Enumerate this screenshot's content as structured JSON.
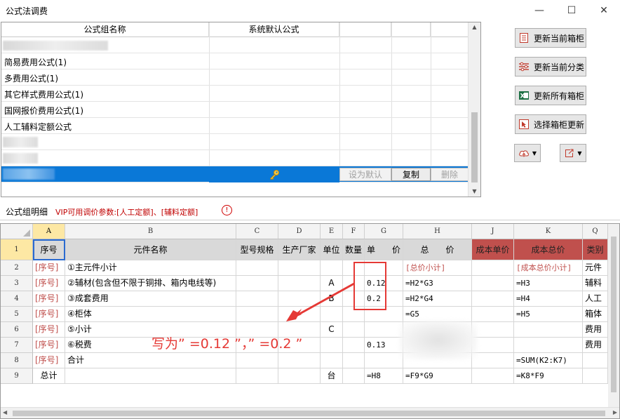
{
  "window": {
    "title": "公式法调费",
    "minimize": "—",
    "maximize": "☐",
    "close": "✕"
  },
  "list": {
    "columns": [
      "公式组名称",
      "系统默认公式"
    ],
    "rows": [
      {
        "name": ""
      },
      {
        "name": "简易费用公式(1)"
      },
      {
        "name": "多费用公式(1)"
      },
      {
        "name": "其它样式费用公式(1)"
      },
      {
        "name": "国网报价费用公式(1)"
      },
      {
        "name": "人工辅料定额公式"
      },
      {
        "name": ""
      },
      {
        "name": ""
      }
    ],
    "selected_row_buttons": {
      "set_default": "设为默认",
      "copy": "复制",
      "delete": "删除"
    },
    "key_icon": "key-icon"
  },
  "side_buttons": {
    "update_current_cabinet": "更新当前箱柜",
    "update_current_category": "更新当前分类",
    "update_all_cabinets": "更新所有箱柜",
    "select_cabinet_update": "选择箱柜更新"
  },
  "section": {
    "tab": "公式组明细",
    "note": "VIP可用调价参数:[人工定额]、[辅料定额]",
    "info": "!"
  },
  "sheet": {
    "col_letters": [
      "A",
      "B",
      "C",
      "D",
      "E",
      "F",
      "G",
      "H",
      "J",
      "K",
      "Q"
    ],
    "row_numbers": [
      "1",
      "2",
      "3",
      "4",
      "5",
      "6",
      "7",
      "8",
      "9"
    ],
    "header": {
      "A": "序号",
      "B": "元件名称",
      "C": "型号规格",
      "D": "生产厂家",
      "E": "单位",
      "F": "数量",
      "G": "单　　价",
      "H": "总　　价",
      "J": "成本单价",
      "K": "成本总价",
      "Q": "类别"
    },
    "rows": [
      {
        "A": "[序号]",
        "B": "①主元件小计",
        "E": "",
        "G": "",
        "H": "[总价小计]",
        "K": "[成本总价小计]",
        "Q": "元件"
      },
      {
        "A": "[序号]",
        "B": "②辅材(包含但不限于铜排、箱内电线等)",
        "E": "A",
        "G": "0.12",
        "H": "=H2*G3",
        "K": "=H3",
        "Q": "辅料"
      },
      {
        "A": "[序号]",
        "B": "③成套费用",
        "E": "B",
        "G": "0.2",
        "H": "=H2*G4",
        "K": "=H4",
        "Q": "人工"
      },
      {
        "A": "[序号]",
        "B": "④柜体",
        "E": "",
        "G": "",
        "H": "=G5",
        "K": "=H5",
        "Q": "箱体"
      },
      {
        "A": "[序号]",
        "B": "⑤小计",
        "E": "C",
        "G": "",
        "H": "",
        "K": "",
        "Q": "费用"
      },
      {
        "A": "[序号]",
        "B": "⑥税费",
        "E": "",
        "G": "0.13",
        "H": "",
        "K": "",
        "Q": "费用"
      },
      {
        "A": "[序号]",
        "B": "合计",
        "E": "",
        "G": "",
        "H": "",
        "K": "=SUM(K2:K7)",
        "Q": ""
      },
      {
        "A": "总计",
        "B": "",
        "E": "台",
        "G": "=H8",
        "H": "=F9*G9",
        "K": "=K8*F9",
        "Q": ""
      }
    ]
  },
  "annotation": {
    "text": "写为” =0.12 ”，” =0.2 ”",
    "color": "#e53935"
  },
  "colors": {
    "selection": "#0a78d7",
    "header_gray": "#d9d9d9",
    "header_red": "#c0504d",
    "red_text": "#c0504d",
    "active_col": "#fde8a4"
  }
}
